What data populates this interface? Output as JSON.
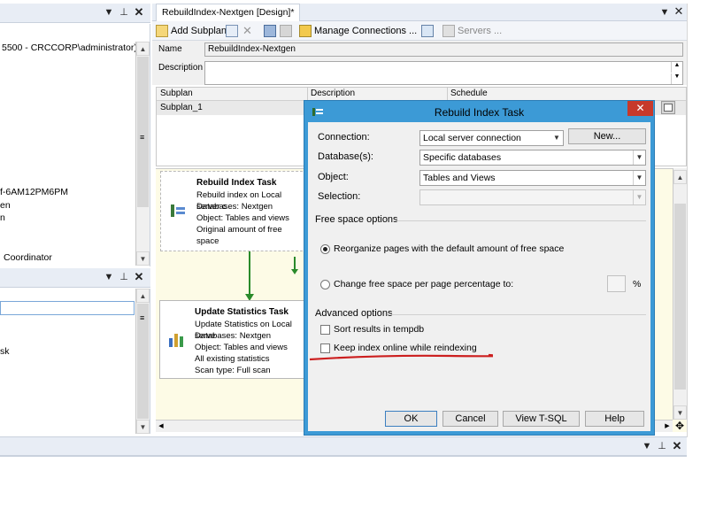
{
  "left_top_panel": {
    "texts": [
      "5500 - CRCCORP\\administrator)",
      "f-6AM12PM6PM",
      "en",
      "n",
      "Coordinator"
    ]
  },
  "left_bottom_panel": {
    "texts": [
      "sk"
    ]
  },
  "doc_tab": {
    "title": "RebuildIndex-Nextgen [Design]*"
  },
  "toolbar": {
    "add_subplan": "Add Subplan",
    "manage_connections": "Manage Connections ...",
    "servers": "Servers ..."
  },
  "plan_form": {
    "name_label": "Name",
    "name_value": "RebuildIndex-Nextgen",
    "description_label": "Description",
    "description_value": ""
  },
  "subplan_grid": {
    "headers": [
      "Subplan",
      "Description",
      "Schedule"
    ],
    "rows": [
      [
        "Subplan_1",
        "",
        ""
      ]
    ]
  },
  "rebuild_task": {
    "title": "Rebuild Index Task",
    "lines": [
      "Rebuild index on Local server c",
      "Databases: Nextgen",
      "Object: Tables and views",
      "Original amount of free space"
    ]
  },
  "update_task": {
    "title": "Update Statistics Task",
    "lines": [
      "Update Statistics on Local serve",
      "Databases: Nextgen",
      "Object: Tables and views",
      "All existing statistics",
      "Scan type: Full scan"
    ]
  },
  "dialog": {
    "title": "Rebuild Index Task",
    "connection_label": "Connection:",
    "connection_value": "Local server connection",
    "new_button": "New...",
    "databases_label": "Database(s):",
    "databases_value": "Specific databases",
    "object_label": "Object:",
    "object_value": "Tables and Views",
    "selection_label": "Selection:",
    "selection_value": "",
    "free_space_section": "Free space options",
    "reorganize_option": "Reorganize pages with the default amount of free space",
    "change_option": "Change free space per page percentage to:",
    "percent_value": "",
    "percent_sign": "%",
    "advanced_section": "Advanced options",
    "sort_option": "Sort results in tempdb",
    "online_option": "Keep index online while reindexing",
    "sort_checked": false,
    "online_checked": false,
    "ok": "OK",
    "cancel": "Cancel",
    "view_tsql": "View T-SQL",
    "help": "Help"
  },
  "colors": {
    "dialog_border": "#3c9ad6",
    "close_button": "#c7392b",
    "annotation_underline": "#cc1f1f",
    "connector_green": "#2a8a2a"
  }
}
